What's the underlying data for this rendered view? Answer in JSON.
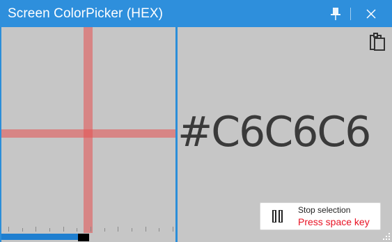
{
  "window": {
    "title": "Screen ColorPicker (HEX)"
  },
  "titlebar": {
    "pin_icon": "pin-icon",
    "close_icon": "close-icon"
  },
  "colors": {
    "titlebar": "#2e8fdc",
    "picked": "#c6c6c6",
    "crosshair": "#e65050",
    "progress": "#1f7fd0",
    "hint_red": "#e81123"
  },
  "magnifier": {
    "crosshair": true,
    "ruler_ticks": 13,
    "progress_fraction": 0.44
  },
  "preview": {
    "hex_value": "#C6C6C6",
    "copy_icon": "clipboard-icon"
  },
  "stop_selection": {
    "title": "Stop selection",
    "hint": "Press space key",
    "icon": "pause-icon"
  }
}
